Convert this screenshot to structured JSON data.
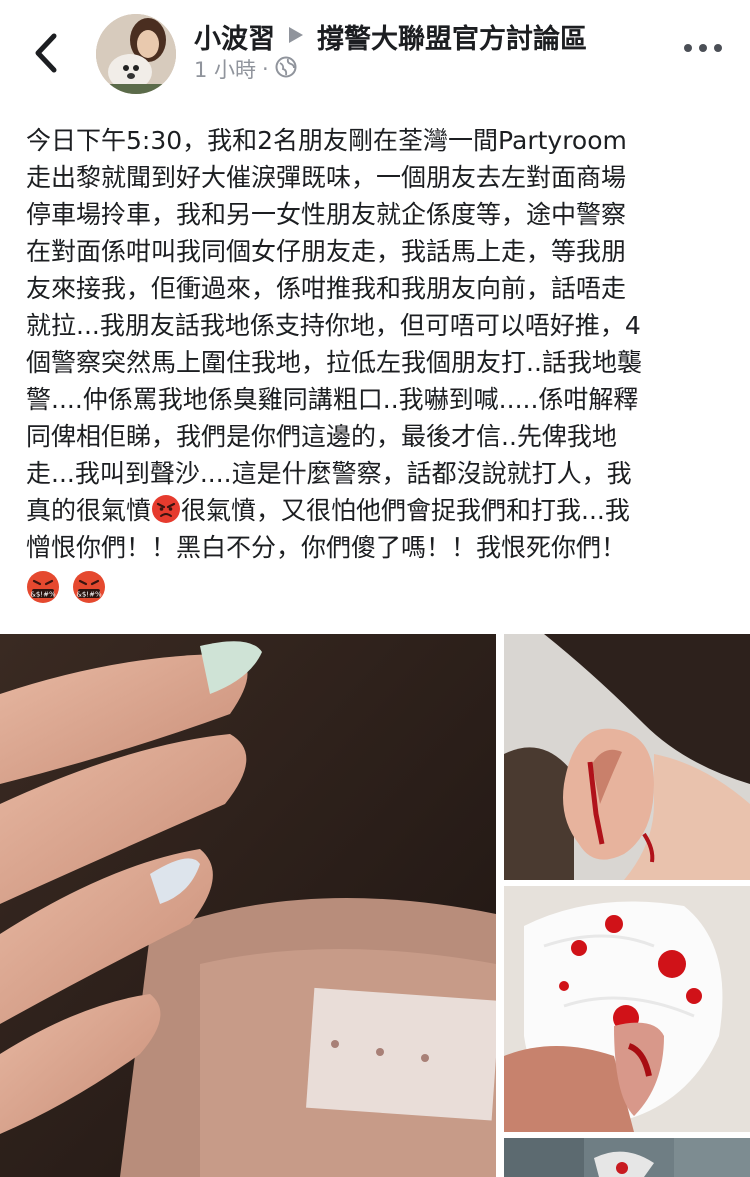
{
  "header": {
    "author": "小波習",
    "group": "撐警大聯盟官方討論區",
    "time": "1 小時",
    "separator": "·"
  },
  "post": {
    "lines": [
      "今日下午5:30，我和2名朋友剛在荃灣一間Partyroom",
      "走出黎就聞到好大催淚彈既味，一個朋友去左對面商場",
      "停車場拎車，我和另一女性朋友就企係度等，途中警察",
      "在對面係咁叫我同個女仔朋友走，我話馬上走，等我朋",
      "友來接我，佢衝過來，係咁推我和我朋友向前，話唔走",
      "就拉...我朋友話我地係支持你地，但可唔可以唔好推，4",
      "個警察突然馬上圍住我地，拉低左我個朋友打..話我地襲",
      "警....仲係罵我地係臭雞同講粗口..我嚇到喊.....係咁解釋",
      "同俾相佢睇，我們是你們這邊的，最後才信..先俾我地",
      "走...我叫到聲沙....這是什麼警察，話都沒說就打人，我"
    ],
    "line11_a": "真的很氣憤",
    "line11_b": "很氣憤，又很怕他們會捉我們和打我...我",
    "line12": "憎恨你們！！黑白不分，你們傻了嗎！！我恨死你們！",
    "emoji_angry": "angry-face-emoji",
    "emoji_cursing": "cursing-face-emoji",
    "cursing_symbols": "&$!#%"
  },
  "colors": {
    "name": "#1c1e21",
    "meta": "#90949c",
    "emoji_red": "#e63b2e",
    "emoji_orange": "#f5a623"
  }
}
